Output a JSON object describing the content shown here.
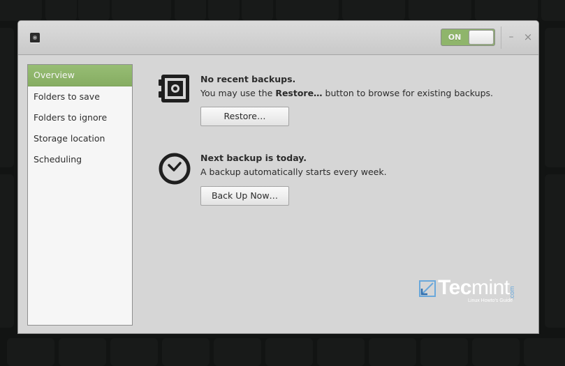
{
  "window": {
    "app_icon": "deja-dup-icon",
    "switch": {
      "label": "ON",
      "state": "on",
      "color": "#8fb56b"
    },
    "minimize_glyph": "–",
    "close_glyph": "×"
  },
  "sidebar": {
    "items": [
      {
        "label": "Overview",
        "active": true
      },
      {
        "label": "Folders to save",
        "active": false
      },
      {
        "label": "Folders to ignore",
        "active": false
      },
      {
        "label": "Storage location",
        "active": false
      },
      {
        "label": "Scheduling",
        "active": false
      }
    ],
    "accent": "#8fb56b"
  },
  "overview": {
    "restore_section": {
      "icon": "safe-icon",
      "title": "No recent backups.",
      "desc_prefix": "You may use the ",
      "desc_bold": "Restore…",
      "desc_suffix": " button to browse for existing backups.",
      "button": "Restore…"
    },
    "schedule_section": {
      "icon": "clock-icon",
      "title": "Next backup is today.",
      "desc": "A backup automatically starts every week.",
      "button": "Back Up Now…"
    }
  },
  "watermark": {
    "brand_light": "Tec",
    "brand_rest": "mint",
    "suffix": ".com",
    "tagline": "Linux Howto's Guide"
  }
}
